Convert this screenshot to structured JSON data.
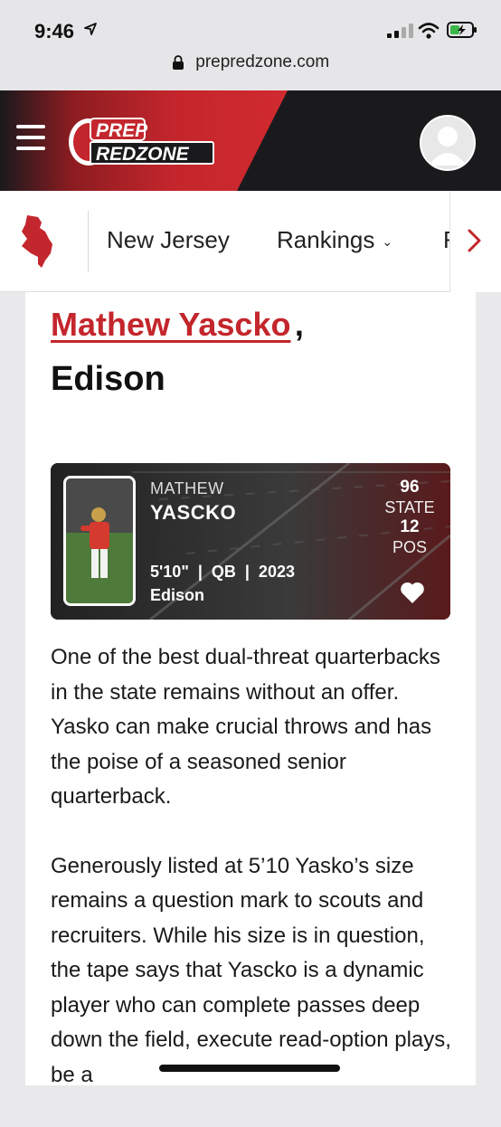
{
  "status_bar": {
    "time": "9:46",
    "url": "prepredzone.com"
  },
  "header": {
    "logo_top": "PREP",
    "logo_bottom": "REDZONE",
    "colors": {
      "red": "#c3262c",
      "dark": "#1a1a1d"
    }
  },
  "nav": {
    "items": [
      {
        "label": "New Jersey"
      },
      {
        "label": "Rankings"
      },
      {
        "label": "F"
      }
    ]
  },
  "article": {
    "player_name": "Mathew Yascko",
    "comma": ",",
    "school": "Edison",
    "card": {
      "first_name": "MATHEW",
      "last_name": "YASCKO",
      "height": "5'10\"",
      "position": "QB",
      "class_year": "2023",
      "stats_line": "5'10\"  |  QB  |  2023",
      "school": "Edison",
      "state_rank": "96",
      "state_label": "STATE",
      "pos_rank": "12",
      "pos_label": "POS"
    },
    "paragraphs": [
      "One of the best dual-threat quarterbacks in the state remains without an offer. Yasko can make crucial throws and has the poise of a seasoned senior quarterback.",
      "Generously listed at 5’10 Yasko’s size remains a question mark to scouts and recruiters. While his size is in question, the tape says that Yascko is a dynamic player who can complete passes deep down the field, execute read-option plays, be a"
    ]
  }
}
